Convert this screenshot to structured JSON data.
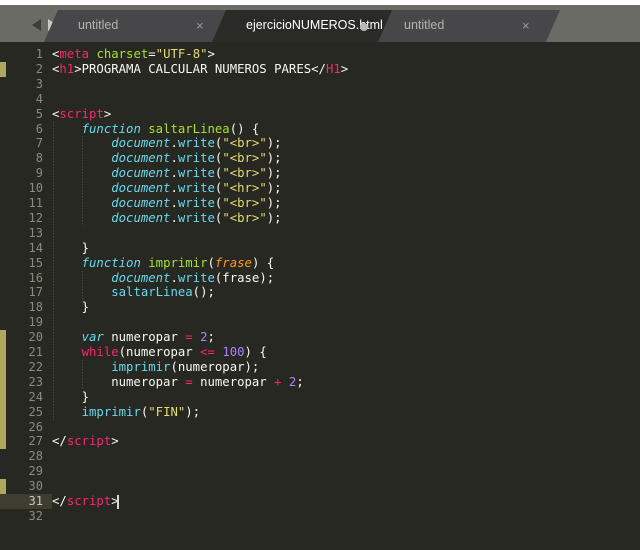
{
  "window": {
    "top_strip_ghost_text": ""
  },
  "tabbar": {
    "nav": {
      "back_icon": "triangle-left-icon",
      "forward_icon": "triangle-right-icon"
    },
    "tabs": [
      {
        "label": "untitled",
        "active": false,
        "dirty": false,
        "close_glyph": "×"
      },
      {
        "label": "ejercicioNUMEROS.html",
        "active": true,
        "dirty": true,
        "close_glyph": "×"
      },
      {
        "label": "untitled",
        "active": false,
        "dirty": false,
        "close_glyph": "×"
      }
    ]
  },
  "editor": {
    "active_line": 31,
    "total_lines": 32,
    "line_numbers": [
      1,
      2,
      3,
      4,
      5,
      6,
      7,
      8,
      9,
      10,
      11,
      12,
      13,
      14,
      15,
      16,
      17,
      18,
      19,
      20,
      21,
      22,
      23,
      24,
      25,
      26,
      27,
      28,
      29,
      30,
      31,
      32
    ],
    "change_markers": [
      {
        "from_line": 2,
        "to_line": 2
      },
      {
        "from_line": 20,
        "to_line": 27
      },
      {
        "from_line": 30,
        "to_line": 30
      }
    ],
    "colors": {
      "background": "#272822",
      "gutter_text": "#8a8a80",
      "active_line_bg": "#3e3d32",
      "change_marker": "#e6db74",
      "tag": "#f92672",
      "attribute": "#a6e22e",
      "string": "#e6db74",
      "keyword": "#66d9ef",
      "keyword_control": "#f92672",
      "function": "#a6e22e",
      "parameter": "#fd971f",
      "number": "#ae81ff",
      "plain": "#f8f8f2",
      "tabbar_bg": "#6b6b66",
      "tab_inactive_bg": "#47474a",
      "tab_active_bg": "#2a2a26"
    },
    "lines": [
      {
        "n": 1,
        "tokens": [
          {
            "t": "<",
            "c": "t-punct"
          },
          {
            "t": "meta",
            "c": "t-tag"
          },
          {
            "t": " ",
            "c": "t-plain"
          },
          {
            "t": "charset",
            "c": "t-attr"
          },
          {
            "t": "=",
            "c": "t-plain"
          },
          {
            "t": "\"UTF-8\"",
            "c": "t-str"
          },
          {
            "t": ">",
            "c": "t-punct"
          }
        ]
      },
      {
        "n": 2,
        "tokens": [
          {
            "t": "<",
            "c": "t-punct"
          },
          {
            "t": "h1",
            "c": "t-tag"
          },
          {
            "t": ">",
            "c": "t-punct"
          },
          {
            "t": "PROGRAMA CALCULAR NUMEROS PARES",
            "c": "t-plain"
          },
          {
            "t": "</",
            "c": "t-punct"
          },
          {
            "t": "H1",
            "c": "t-tag"
          },
          {
            "t": ">",
            "c": "t-punct"
          }
        ]
      },
      {
        "n": 3,
        "tokens": []
      },
      {
        "n": 4,
        "tokens": []
      },
      {
        "n": 5,
        "tokens": [
          {
            "t": "<",
            "c": "t-punct"
          },
          {
            "t": "script",
            "c": "t-tag"
          },
          {
            "t": ">",
            "c": "t-punct"
          }
        ]
      },
      {
        "n": 6,
        "tokens": [
          {
            "t": "    ",
            "c": "t-plain"
          },
          {
            "t": "function",
            "c": "t-kw"
          },
          {
            "t": " ",
            "c": "t-plain"
          },
          {
            "t": "saltarLinea",
            "c": "t-fn"
          },
          {
            "t": "() {",
            "c": "t-plain"
          }
        ]
      },
      {
        "n": 7,
        "tokens": [
          {
            "t": "        ",
            "c": "t-plain"
          },
          {
            "t": "document",
            "c": "t-obj"
          },
          {
            "t": ".",
            "c": "t-plain"
          },
          {
            "t": "write",
            "c": "t-prop"
          },
          {
            "t": "(",
            "c": "t-plain"
          },
          {
            "t": "\"<br>\"",
            "c": "t-str"
          },
          {
            "t": ");",
            "c": "t-plain"
          }
        ]
      },
      {
        "n": 8,
        "tokens": [
          {
            "t": "        ",
            "c": "t-plain"
          },
          {
            "t": "document",
            "c": "t-obj"
          },
          {
            "t": ".",
            "c": "t-plain"
          },
          {
            "t": "write",
            "c": "t-prop"
          },
          {
            "t": "(",
            "c": "t-plain"
          },
          {
            "t": "\"<br>\"",
            "c": "t-str"
          },
          {
            "t": ");",
            "c": "t-plain"
          }
        ]
      },
      {
        "n": 9,
        "tokens": [
          {
            "t": "        ",
            "c": "t-plain"
          },
          {
            "t": "document",
            "c": "t-obj"
          },
          {
            "t": ".",
            "c": "t-plain"
          },
          {
            "t": "write",
            "c": "t-prop"
          },
          {
            "t": "(",
            "c": "t-plain"
          },
          {
            "t": "\"<br>\"",
            "c": "t-str"
          },
          {
            "t": ");",
            "c": "t-plain"
          }
        ]
      },
      {
        "n": 10,
        "tokens": [
          {
            "t": "        ",
            "c": "t-plain"
          },
          {
            "t": "document",
            "c": "t-obj"
          },
          {
            "t": ".",
            "c": "t-plain"
          },
          {
            "t": "write",
            "c": "t-prop"
          },
          {
            "t": "(",
            "c": "t-plain"
          },
          {
            "t": "\"<hr>\"",
            "c": "t-str"
          },
          {
            "t": ");",
            "c": "t-plain"
          }
        ]
      },
      {
        "n": 11,
        "tokens": [
          {
            "t": "        ",
            "c": "t-plain"
          },
          {
            "t": "document",
            "c": "t-obj"
          },
          {
            "t": ".",
            "c": "t-plain"
          },
          {
            "t": "write",
            "c": "t-prop"
          },
          {
            "t": "(",
            "c": "t-plain"
          },
          {
            "t": "\"<br>\"",
            "c": "t-str"
          },
          {
            "t": ");",
            "c": "t-plain"
          }
        ]
      },
      {
        "n": 12,
        "tokens": [
          {
            "t": "        ",
            "c": "t-plain"
          },
          {
            "t": "document",
            "c": "t-obj"
          },
          {
            "t": ".",
            "c": "t-plain"
          },
          {
            "t": "write",
            "c": "t-prop"
          },
          {
            "t": "(",
            "c": "t-plain"
          },
          {
            "t": "\"<br>\"",
            "c": "t-str"
          },
          {
            "t": ");",
            "c": "t-plain"
          }
        ]
      },
      {
        "n": 13,
        "tokens": []
      },
      {
        "n": 14,
        "tokens": [
          {
            "t": "    }",
            "c": "t-plain"
          }
        ]
      },
      {
        "n": 15,
        "tokens": [
          {
            "t": "    ",
            "c": "t-plain"
          },
          {
            "t": "function",
            "c": "t-kw"
          },
          {
            "t": " ",
            "c": "t-plain"
          },
          {
            "t": "imprimir",
            "c": "t-fn"
          },
          {
            "t": "(",
            "c": "t-plain"
          },
          {
            "t": "frase",
            "c": "t-param"
          },
          {
            "t": ") {",
            "c": "t-plain"
          }
        ]
      },
      {
        "n": 16,
        "tokens": [
          {
            "t": "        ",
            "c": "t-plain"
          },
          {
            "t": "document",
            "c": "t-obj"
          },
          {
            "t": ".",
            "c": "t-plain"
          },
          {
            "t": "write",
            "c": "t-prop"
          },
          {
            "t": "(frase);",
            "c": "t-plain"
          }
        ]
      },
      {
        "n": 17,
        "tokens": [
          {
            "t": "        ",
            "c": "t-plain"
          },
          {
            "t": "saltarLinea",
            "c": "t-prop"
          },
          {
            "t": "();",
            "c": "t-plain"
          }
        ]
      },
      {
        "n": 18,
        "tokens": [
          {
            "t": "    }",
            "c": "t-plain"
          }
        ]
      },
      {
        "n": 19,
        "tokens": []
      },
      {
        "n": 20,
        "tokens": [
          {
            "t": "    ",
            "c": "t-plain"
          },
          {
            "t": "var",
            "c": "t-kw"
          },
          {
            "t": " numeropar ",
            "c": "t-plain"
          },
          {
            "t": "=",
            "c": "t-op"
          },
          {
            "t": " ",
            "c": "t-plain"
          },
          {
            "t": "2",
            "c": "t-num"
          },
          {
            "t": ";",
            "c": "t-plain"
          }
        ]
      },
      {
        "n": 21,
        "tokens": [
          {
            "t": "    ",
            "c": "t-plain"
          },
          {
            "t": "while",
            "c": "t-kw2"
          },
          {
            "t": "(numeropar ",
            "c": "t-plain"
          },
          {
            "t": "<=",
            "c": "t-op"
          },
          {
            "t": " ",
            "c": "t-plain"
          },
          {
            "t": "100",
            "c": "t-num"
          },
          {
            "t": ") {",
            "c": "t-plain"
          }
        ]
      },
      {
        "n": 22,
        "tokens": [
          {
            "t": "        ",
            "c": "t-plain"
          },
          {
            "t": "imprimir",
            "c": "t-prop"
          },
          {
            "t": "(numeropar);",
            "c": "t-plain"
          }
        ]
      },
      {
        "n": 23,
        "tokens": [
          {
            "t": "        numeropar ",
            "c": "t-plain"
          },
          {
            "t": "=",
            "c": "t-op"
          },
          {
            "t": " numeropar ",
            "c": "t-plain"
          },
          {
            "t": "+",
            "c": "t-op"
          },
          {
            "t": " ",
            "c": "t-plain"
          },
          {
            "t": "2",
            "c": "t-num"
          },
          {
            "t": ";",
            "c": "t-plain"
          }
        ]
      },
      {
        "n": 24,
        "tokens": [
          {
            "t": "    }",
            "c": "t-plain"
          }
        ]
      },
      {
        "n": 25,
        "tokens": [
          {
            "t": "    ",
            "c": "t-plain"
          },
          {
            "t": "imprimir",
            "c": "t-prop"
          },
          {
            "t": "(",
            "c": "t-plain"
          },
          {
            "t": "\"FIN\"",
            "c": "t-str"
          },
          {
            "t": ");",
            "c": "t-plain"
          }
        ]
      },
      {
        "n": 26,
        "tokens": []
      },
      {
        "n": 27,
        "tokens": [
          {
            "t": "</",
            "c": "t-punct"
          },
          {
            "t": "script",
            "c": "t-tag"
          },
          {
            "t": ">",
            "c": "t-punct"
          }
        ]
      },
      {
        "n": 28,
        "tokens": []
      },
      {
        "n": 29,
        "tokens": []
      },
      {
        "n": 30,
        "tokens": []
      },
      {
        "n": 31,
        "tokens": [
          {
            "t": "</",
            "c": "t-punct"
          },
          {
            "t": "script",
            "c": "t-tag"
          },
          {
            "t": ">",
            "c": "t-punct"
          }
        ]
      },
      {
        "n": 32,
        "tokens": []
      }
    ]
  }
}
